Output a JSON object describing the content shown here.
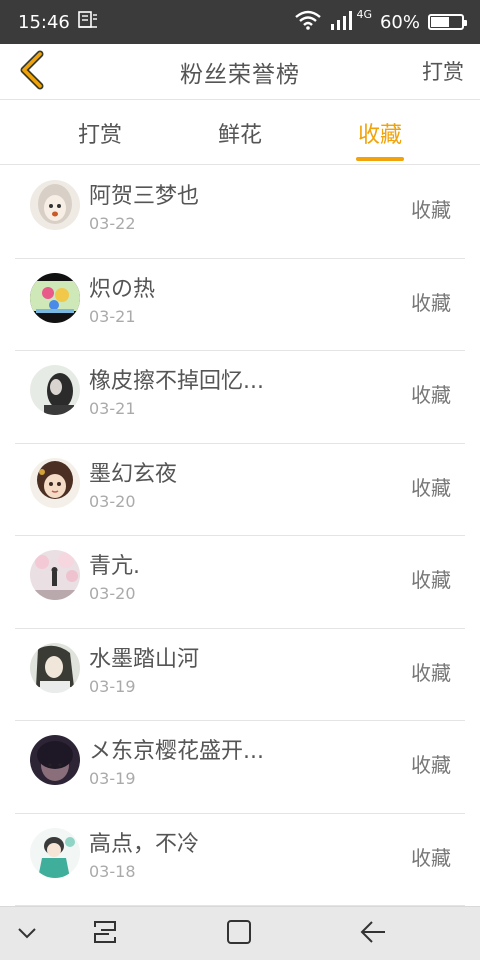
{
  "status_bar": {
    "time": "15:46",
    "network_type": "4G",
    "battery_percent": "60%",
    "battery_level": 0.6,
    "icons": [
      "notification-icon",
      "wifi-icon",
      "signal-icon",
      "battery-icon"
    ]
  },
  "header": {
    "title": "粉丝荣誉榜",
    "action_label": "打赏",
    "back_icon": "chevron-left-icon",
    "back_icon_color": "#f0a30a"
  },
  "tabs": [
    {
      "label": "打赏",
      "active": false
    },
    {
      "label": "鲜花",
      "active": false
    },
    {
      "label": "收藏",
      "active": true
    }
  ],
  "accent_color": "#f0a30a",
  "fans": [
    {
      "name": "阿贺三梦也",
      "date": "03-22",
      "action": "收藏"
    },
    {
      "name": "炽の热",
      "date": "03-21",
      "action": "收藏"
    },
    {
      "name": "橡皮擦不掉回忆...",
      "date": "03-21",
      "action": "收藏"
    },
    {
      "name": "墨幻玄夜",
      "date": "03-20",
      "action": "收藏"
    },
    {
      "name": "青亢.",
      "date": "03-20",
      "action": "收藏"
    },
    {
      "name": "水墨踏山河",
      "date": "03-19",
      "action": "收藏"
    },
    {
      "name": "メ东京樱花盛开...",
      "date": "03-19",
      "action": "收藏"
    },
    {
      "name": "高点，不冷",
      "date": "03-18",
      "action": "收藏"
    }
  ],
  "nav_bar": {
    "icons": [
      "chevron-down-icon",
      "recent-apps-icon",
      "home-icon",
      "back-arrow-icon"
    ]
  }
}
